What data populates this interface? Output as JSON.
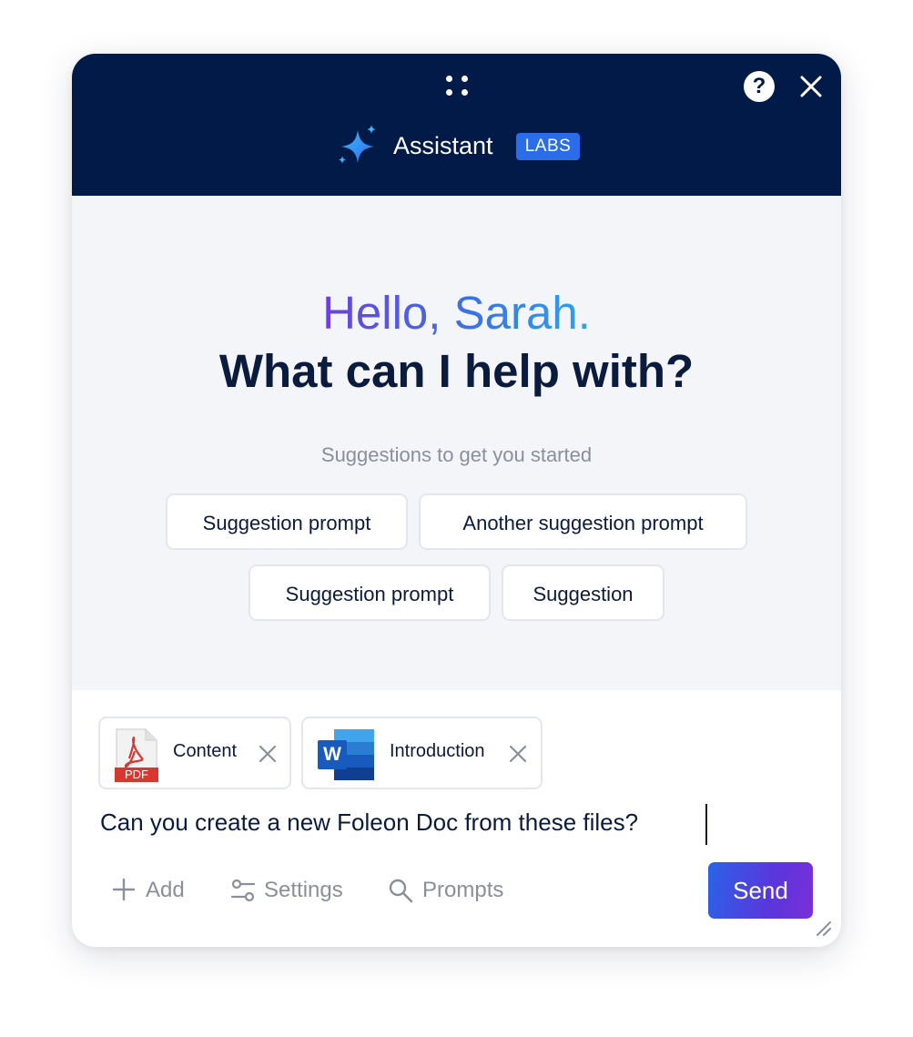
{
  "header": {
    "app_name": "Assistant",
    "badge": "LABS",
    "help_symbol": "?",
    "icons": [
      "drag-handle-icon",
      "help-icon",
      "close-icon",
      "sparkle-icon"
    ],
    "colors": {
      "background": "#021a47",
      "badge": "#2b6de8"
    }
  },
  "welcome": {
    "greeting": "Hello, Sarah.",
    "headline": "What can I help with?",
    "suggestions_label": "Suggestions to get you started",
    "suggestions": [
      "Suggestion prompt",
      "Another suggestion prompt",
      "Suggestion prompt",
      "Suggestion"
    ]
  },
  "composer": {
    "attachments": [
      {
        "name": "Content",
        "type_label": "PDF",
        "icon": "pdf-file-icon"
      },
      {
        "name": "Introduction",
        "type_label": "W",
        "icon": "word-file-icon"
      }
    ],
    "message": "Can you create a new Foleon Doc from these files?",
    "tools": [
      {
        "label": "Add",
        "icon": "plus-icon"
      },
      {
        "label": "Settings",
        "icon": "sliders-icon"
      },
      {
        "label": "Prompts",
        "icon": "search-icon"
      }
    ],
    "send_label": "Send",
    "colors": {
      "send_start": "#2a62e8",
      "send_end": "#7a2fd8"
    }
  }
}
